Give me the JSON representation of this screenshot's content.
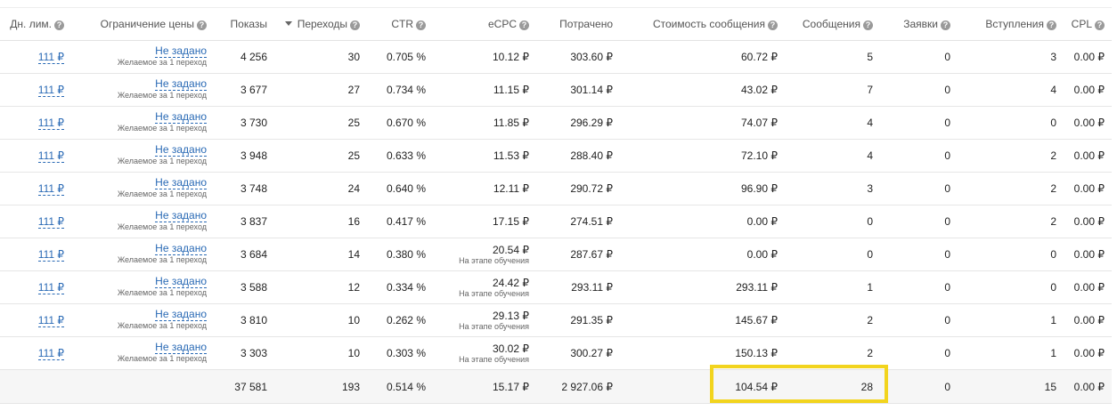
{
  "headers": {
    "day_limit": "Дн. лим.",
    "price_limit": "Ограничение цены",
    "impressions": "Показы",
    "clicks": "Переходы",
    "ctr": "CTR",
    "ecpc": "eCPC",
    "spent": "Потрачено",
    "msg_cost": "Стоимость сообщения",
    "messages": "Сообщения",
    "applications": "Заявки",
    "joins": "Вступления",
    "cpl": "CPL"
  },
  "rows": [
    {
      "day_limit": "111 ₽",
      "price_limit": "Не задано",
      "price_note": "Желаемое за 1 переход",
      "impressions": "4 256",
      "clicks": "30",
      "ctr": "0.705 %",
      "ecpc": "10.12 ₽",
      "ecpc_note": "",
      "spent": "303.60 ₽",
      "msg_cost": "60.72 ₽",
      "messages": "5",
      "applications": "0",
      "joins": "3",
      "cpl": "0.00 ₽"
    },
    {
      "day_limit": "111 ₽",
      "price_limit": "Не задано",
      "price_note": "Желаемое за 1 переход",
      "impressions": "3 677",
      "clicks": "27",
      "ctr": "0.734 %",
      "ecpc": "11.15 ₽",
      "ecpc_note": "",
      "spent": "301.14 ₽",
      "msg_cost": "43.02 ₽",
      "messages": "7",
      "applications": "0",
      "joins": "4",
      "cpl": "0.00 ₽"
    },
    {
      "day_limit": "111 ₽",
      "price_limit": "Не задано",
      "price_note": "Желаемое за 1 переход",
      "impressions": "3 730",
      "clicks": "25",
      "ctr": "0.670 %",
      "ecpc": "11.85 ₽",
      "ecpc_note": "",
      "spent": "296.29 ₽",
      "msg_cost": "74.07 ₽",
      "messages": "4",
      "applications": "0",
      "joins": "0",
      "cpl": "0.00 ₽"
    },
    {
      "day_limit": "111 ₽",
      "price_limit": "Не задано",
      "price_note": "Желаемое за 1 переход",
      "impressions": "3 948",
      "clicks": "25",
      "ctr": "0.633 %",
      "ecpc": "11.53 ₽",
      "ecpc_note": "",
      "spent": "288.40 ₽",
      "msg_cost": "72.10 ₽",
      "messages": "4",
      "applications": "0",
      "joins": "2",
      "cpl": "0.00 ₽"
    },
    {
      "day_limit": "111 ₽",
      "price_limit": "Не задано",
      "price_note": "Желаемое за 1 переход",
      "impressions": "3 748",
      "clicks": "24",
      "ctr": "0.640 %",
      "ecpc": "12.11 ₽",
      "ecpc_note": "",
      "spent": "290.72 ₽",
      "msg_cost": "96.90 ₽",
      "messages": "3",
      "applications": "0",
      "joins": "2",
      "cpl": "0.00 ₽"
    },
    {
      "day_limit": "111 ₽",
      "price_limit": "Не задано",
      "price_note": "Желаемое за 1 переход",
      "impressions": "3 837",
      "clicks": "16",
      "ctr": "0.417 %",
      "ecpc": "17.15 ₽",
      "ecpc_note": "",
      "spent": "274.51 ₽",
      "msg_cost": "0.00 ₽",
      "messages": "0",
      "applications": "0",
      "joins": "2",
      "cpl": "0.00 ₽"
    },
    {
      "day_limit": "111 ₽",
      "price_limit": "Не задано",
      "price_note": "Желаемое за 1 переход",
      "impressions": "3 684",
      "clicks": "14",
      "ctr": "0.380 %",
      "ecpc": "20.54 ₽",
      "ecpc_note": "На этапе обучения",
      "spent": "287.67 ₽",
      "msg_cost": "0.00 ₽",
      "messages": "0",
      "applications": "0",
      "joins": "0",
      "cpl": "0.00 ₽"
    },
    {
      "day_limit": "111 ₽",
      "price_limit": "Не задано",
      "price_note": "Желаемое за 1 переход",
      "impressions": "3 588",
      "clicks": "12",
      "ctr": "0.334 %",
      "ecpc": "24.42 ₽",
      "ecpc_note": "На этапе обучения",
      "spent": "293.11 ₽",
      "msg_cost": "293.11 ₽",
      "messages": "1",
      "applications": "0",
      "joins": "0",
      "cpl": "0.00 ₽"
    },
    {
      "day_limit": "111 ₽",
      "price_limit": "Не задано",
      "price_note": "Желаемое за 1 переход",
      "impressions": "3 810",
      "clicks": "10",
      "ctr": "0.262 %",
      "ecpc": "29.13 ₽",
      "ecpc_note": "На этапе обучения",
      "spent": "291.35 ₽",
      "msg_cost": "145.67 ₽",
      "messages": "2",
      "applications": "0",
      "joins": "1",
      "cpl": "0.00 ₽"
    },
    {
      "day_limit": "111 ₽",
      "price_limit": "Не задано",
      "price_note": "Желаемое за 1 переход",
      "impressions": "3 303",
      "clicks": "10",
      "ctr": "0.303 %",
      "ecpc": "30.02 ₽",
      "ecpc_note": "На этапе обучения",
      "spent": "300.27 ₽",
      "msg_cost": "150.13 ₽",
      "messages": "2",
      "applications": "0",
      "joins": "1",
      "cpl": "0.00 ₽"
    }
  ],
  "totals": {
    "impressions": "37 581",
    "clicks": "193",
    "ctr": "0.514 %",
    "ecpc": "15.17 ₽",
    "spent": "2 927.06 ₽",
    "msg_cost": "104.54 ₽",
    "messages": "28",
    "applications": "0",
    "joins": "15",
    "cpl": "0.00 ₽"
  },
  "icons": {
    "help": "question-circle-icon",
    "sort": "sort-desc-icon"
  },
  "colors": {
    "link": "#2a6ab5",
    "highlight": "#f2d41e",
    "totals_bg": "#f6f6f6"
  }
}
